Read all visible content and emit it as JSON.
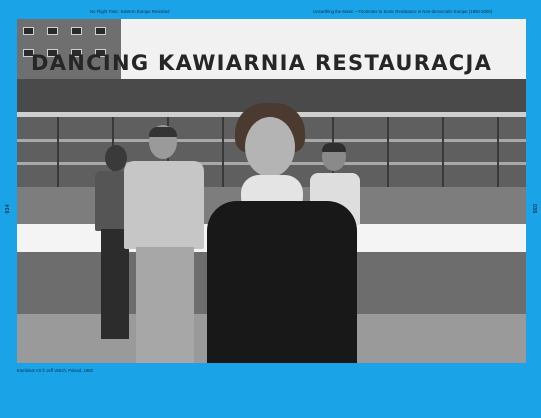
{
  "header": {
    "left": "No Flight Tonic: Eastern Europe Revisited",
    "right": "Unearthing the Music – Footnotes to Sonic Resistance in Non-democratic Europe (1950-2000)"
  },
  "folios": {
    "left": "034",
    "right": "035"
  },
  "photo": {
    "sign_text": "DANCING KAWIARNIA RESTAURACJA"
  },
  "caption": "Kombinat VII © Jeff Vettch, Poland, 1983"
}
